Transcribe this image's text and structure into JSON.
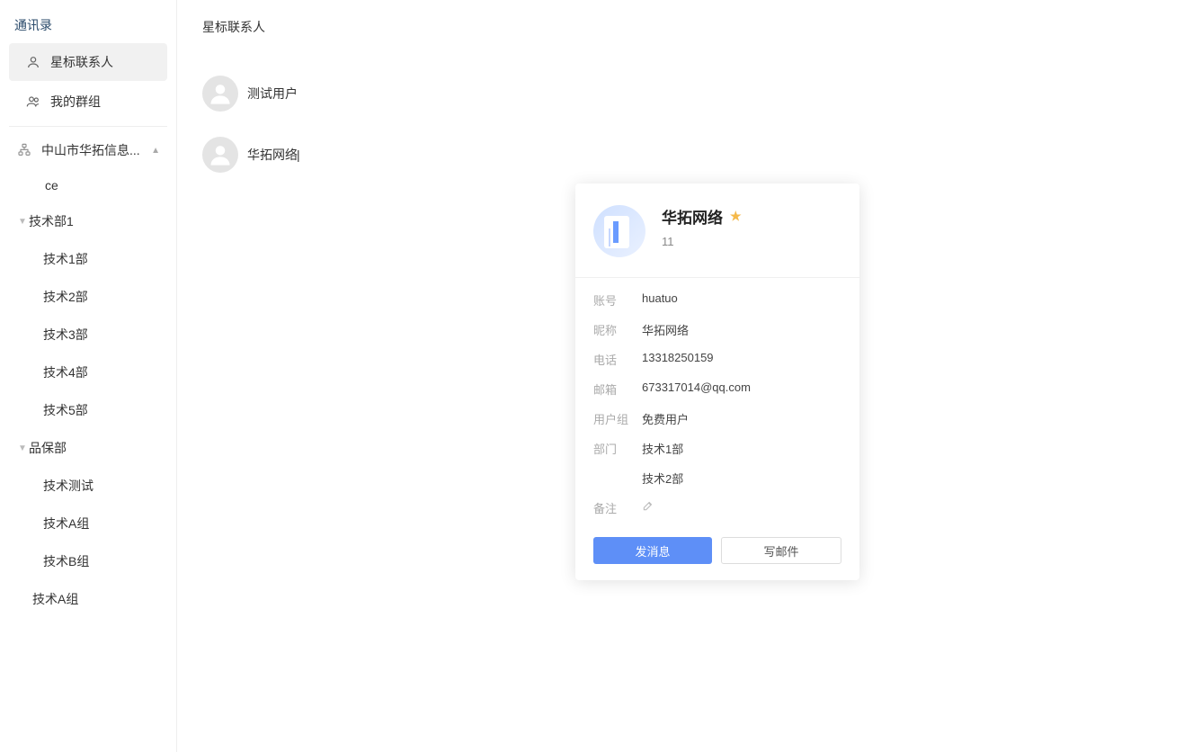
{
  "sidebar": {
    "title": "通讯录",
    "nav": {
      "starred": "星标联系人",
      "groups": "我的群组"
    },
    "org": {
      "name": "中山市华拓信息...",
      "ce": "ce",
      "tech1": {
        "label": "技术部1",
        "children": [
          "技术1部",
          "技术2部",
          "技术3部",
          "技术4部",
          "技术5部"
        ]
      },
      "qa": {
        "label": "品保部",
        "children": [
          "技术测试",
          "技术A组",
          "技术B组"
        ]
      },
      "techA": "技术A组"
    }
  },
  "main": {
    "title": "星标联系人",
    "contacts": [
      {
        "name": "测试用户"
      },
      {
        "name": "华拓网络"
      }
    ]
  },
  "card": {
    "name": "华拓网络",
    "sub": "11",
    "fields": {
      "account_label": "账号",
      "account_value": "huatuo",
      "nickname_label": "昵称",
      "nickname_value": "华拓网络",
      "phone_label": "电话",
      "phone_value": "13318250159",
      "email_label": "邮箱",
      "email_value": "673317014@qq.com",
      "usergroup_label": "用户组",
      "usergroup_value": "免费用户",
      "dept_label": "部门",
      "dept_value": "技术1部",
      "dept_value2": "技术2部",
      "note_label": "备注"
    },
    "buttons": {
      "send": "发消息",
      "mail": "写邮件"
    }
  }
}
